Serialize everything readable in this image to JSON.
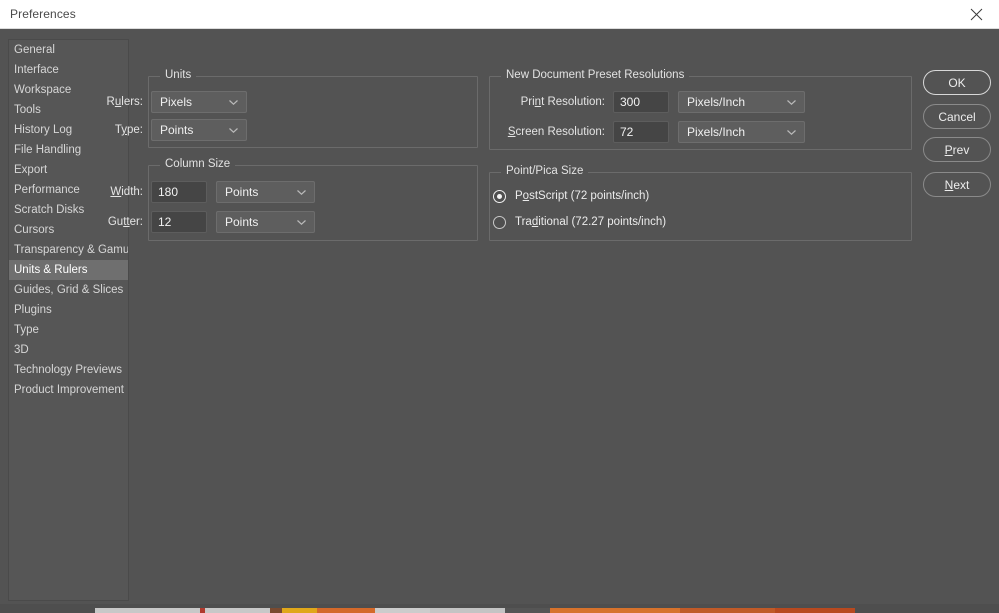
{
  "window": {
    "title": "Preferences",
    "close_icon": "close-icon"
  },
  "sidebar": {
    "items": [
      {
        "label": "General",
        "selected": false
      },
      {
        "label": "Interface",
        "selected": false
      },
      {
        "label": "Workspace",
        "selected": false
      },
      {
        "label": "Tools",
        "selected": false
      },
      {
        "label": "History Log",
        "selected": false
      },
      {
        "label": "File Handling",
        "selected": false
      },
      {
        "label": "Export",
        "selected": false
      },
      {
        "label": "Performance",
        "selected": false
      },
      {
        "label": "Scratch Disks",
        "selected": false
      },
      {
        "label": "Cursors",
        "selected": false
      },
      {
        "label": "Transparency & Gamut",
        "selected": false
      },
      {
        "label": "Units & Rulers",
        "selected": true
      },
      {
        "label": "Guides, Grid & Slices",
        "selected": false
      },
      {
        "label": "Plugins",
        "selected": false
      },
      {
        "label": "Type",
        "selected": false
      },
      {
        "label": "3D",
        "selected": false
      },
      {
        "label": "Technology Previews",
        "selected": false
      },
      {
        "label": "Product Improvement",
        "selected": false
      }
    ]
  },
  "units_group": {
    "title": "Units",
    "rulers": {
      "label_pre": "R",
      "label_mnemonic": "u",
      "label_post": "lers:",
      "value": "Pixels"
    },
    "type": {
      "label_pre": "T",
      "label_mnemonic": "y",
      "label_post": "pe:",
      "value": "Points"
    }
  },
  "column_group": {
    "title": "Column Size",
    "width": {
      "label_pre": "",
      "label_mnemonic": "W",
      "label_post": "idth:",
      "value": "180",
      "unit": "Points"
    },
    "gutter": {
      "label_pre": "Gu",
      "label_mnemonic": "tt",
      "label_post": "er:",
      "value": "12",
      "unit": "Points"
    }
  },
  "resolutions_group": {
    "title": "New Document Preset Resolutions",
    "print": {
      "label_pre": "Pri",
      "label_mnemonic": "n",
      "label_post": "t Resolution:",
      "value": "300",
      "unit": "Pixels/Inch"
    },
    "screen": {
      "label_pre": "",
      "label_mnemonic": "S",
      "label_post": "creen Resolution:",
      "value": "72",
      "unit": "Pixels/Inch"
    }
  },
  "pointpica_group": {
    "title": "Point/Pica Size",
    "options": [
      {
        "label_pre": "P",
        "label_mnemonic": "o",
        "label_post": "stScript (72 points/inch)",
        "selected": true
      },
      {
        "label_pre": "Tra",
        "label_mnemonic": "d",
        "label_post": "itional (72.27 points/inch)",
        "selected": false
      }
    ]
  },
  "buttons": {
    "ok": "OK",
    "cancel": "Cancel",
    "prev_pre": "",
    "prev_mnemonic": "P",
    "prev_post": "rev",
    "next_pre": "",
    "next_mnemonic": "N",
    "next_post": "ext"
  },
  "colors": {
    "dialog_bg": "#535353",
    "sidebar_bg": "#565656",
    "sidebar_selected": "#6f6f6f",
    "titlebar_bg": "#ffffff",
    "input_bg": "#454545",
    "dropdown_bg": "#5e5e5e",
    "text": "#e4e4e4"
  }
}
